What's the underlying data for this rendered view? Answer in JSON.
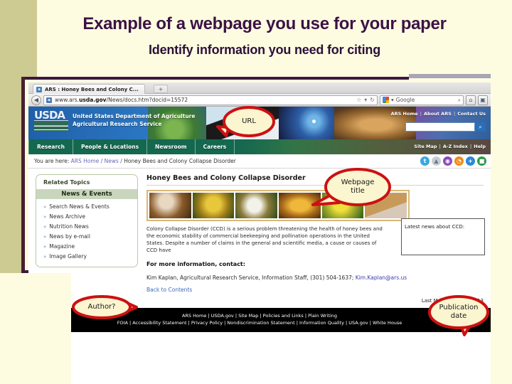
{
  "slide": {
    "title": "Example of a webpage you use for your paper",
    "subtitle": "Identify information you need for citing"
  },
  "browser": {
    "tab_title": "ARS : Honey Bees and Colony C...",
    "tab_favicon": "ars-favicon",
    "new_tab_label": "+",
    "back_icon": "◀",
    "url_prefix": "www.ars.",
    "url_domain": "usda.gov",
    "url_suffix": "/News/docs.htm?docid=15572",
    "star_icon": "☆",
    "dropdown_icon": "▾",
    "reload_icon": "↻",
    "search_engine": "Google",
    "search_icon": "⌕",
    "home_icon": "⌂",
    "menu_icon": "▣"
  },
  "site_header": {
    "logo_word": "USDA",
    "agency_line1": "United States Department of Agriculture",
    "agency_line2": "Agricultural Research Service",
    "links": [
      "ARS Home",
      "About ARS",
      "Contact Us"
    ],
    "search_button_icon": "⌕"
  },
  "nav": {
    "items": [
      "Research",
      "People & Locations",
      "Newsroom",
      "Careers"
    ],
    "right_links": [
      "Site Map",
      "A-Z Index",
      "Help"
    ]
  },
  "breadcrumb": {
    "prefix": "You are here:",
    "home": "ARS Home",
    "sep": "/",
    "news": "News",
    "current": "Honey Bees and Colony Collapse Disorder"
  },
  "social_icons": [
    {
      "name": "twitter-icon",
      "glyph": "t",
      "color": "#3aa8e0"
    },
    {
      "name": "share-icon",
      "glyph": "▲",
      "color": "#c8cdd2"
    },
    {
      "name": "podcast-icon",
      "glyph": "◉",
      "color": "#8a4ab8"
    },
    {
      "name": "rss-icon",
      "glyph": "◔",
      "color": "#ef8a1a"
    },
    {
      "name": "add-icon",
      "glyph": "+",
      "color": "#2a8ad8"
    },
    {
      "name": "video-icon",
      "glyph": "■",
      "color": "#2a9a4a"
    }
  ],
  "sidebar": {
    "heading": "Related Topics",
    "section": "News & Events",
    "bullet": "»",
    "items": [
      "Search News & Events",
      "News Archive",
      "Nutrition News",
      "News by e-mail",
      "Magazine",
      "Image Gallery"
    ]
  },
  "article": {
    "heading": "Honey Bees and Colony Collapse Disorder",
    "body": "Colony Collapse Disorder (CCD) is a serious problem threatening the health of honey bees and the economic stability of commercial beekeeping and pollination operations in the United States. Despite a number of claims in the general and scientific media, a cause or causes of CCD have",
    "news_box": "Latest news about CCD:",
    "contact_heading": "For more information, contact:",
    "contact_text": "Kim Kaplan, Agricultural Research Service, Information Staff, (301) 504-1637; ",
    "contact_email": "Kim.Kaplan@ars.us",
    "back_link": "Back to Contents",
    "last_modified": "Last Modified: 12/2/2013"
  },
  "footer": {
    "line1": "ARS Home | USDA.gov | Site Map | Policies and Links | Plain Writing",
    "line2": "FOIA | Accessibility Statement | Privacy Policy | Nondiscrimination Statement | Information Quality | USA.gov | White House"
  },
  "callouts": {
    "url": "URL",
    "title_line1": "Webpage",
    "title_line2": "title",
    "author": "Author?",
    "pub_line1": "Publication",
    "pub_line2": "date"
  },
  "colors": {
    "slide_bg": "#fdfce0",
    "title_purple": "#3b1245",
    "band_olive": "#cdcb92",
    "callout_red": "#cc1111",
    "callout_fill": "#fbf5d0",
    "nav_green": "#14684f"
  }
}
